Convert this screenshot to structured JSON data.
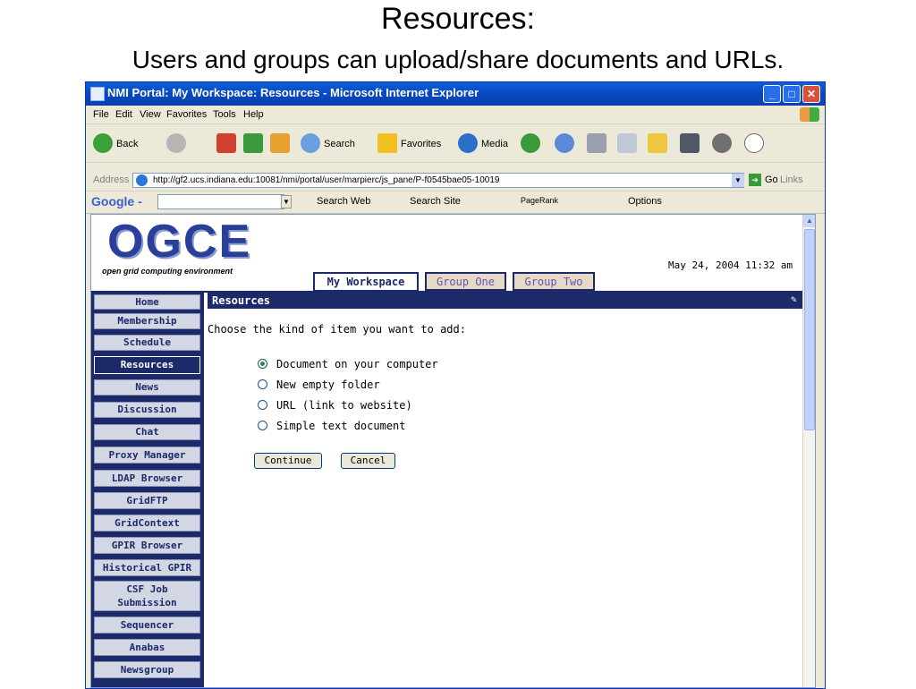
{
  "slide": {
    "title": "Resources:",
    "subtitle": "Users and groups can upload/share documents and URLs."
  },
  "window": {
    "title": "NMI Portal: My Workspace: Resources - Microsoft Internet Explorer",
    "minimize": "_",
    "maximize": "□",
    "close": "✕"
  },
  "menu": [
    "File",
    "Edit",
    "View",
    "Favorites",
    "Tools",
    "Help"
  ],
  "toolbar": {
    "back": "Back",
    "search": "Search",
    "favorites": "Favorites",
    "media": "Media"
  },
  "address": {
    "label": "Address",
    "url": "http://gf2.ucs.indiana.edu:10081/nmi/portal/user/marpierc/js_pane/P-f0545bae05-10019",
    "go": "Go",
    "links": "Links"
  },
  "googlebar": {
    "logo": "Google -",
    "search_web": "Search Web",
    "search_site": "Search Site",
    "pagerank": "PageRank",
    "options": "Options"
  },
  "portal": {
    "logo": "OGCE",
    "tagline": "open grid computing environment",
    "date": "May 24, 2004 11:32 am",
    "tabs": [
      "My Workspace",
      "Group One",
      "Group Two"
    ],
    "nav": [
      "Home",
      "Membership",
      "Schedule",
      "Resources",
      "News",
      "Discussion",
      "Chat",
      "Proxy Manager",
      "LDAP Browser",
      "GridFTP",
      "GridContext",
      "GPIR Browser",
      "Historical GPIR",
      "CSF Job Submission",
      "Sequencer",
      "Anabas",
      "Newsgroup"
    ],
    "active_nav": "Resources",
    "section_title": "Resources",
    "prompt": "Choose the kind of item you want to add:",
    "options": [
      "Document on your computer",
      "New empty folder",
      "URL (link to website)",
      "Simple text document"
    ],
    "selected_option": "Document on your computer",
    "continue": "Continue",
    "cancel": "Cancel"
  }
}
